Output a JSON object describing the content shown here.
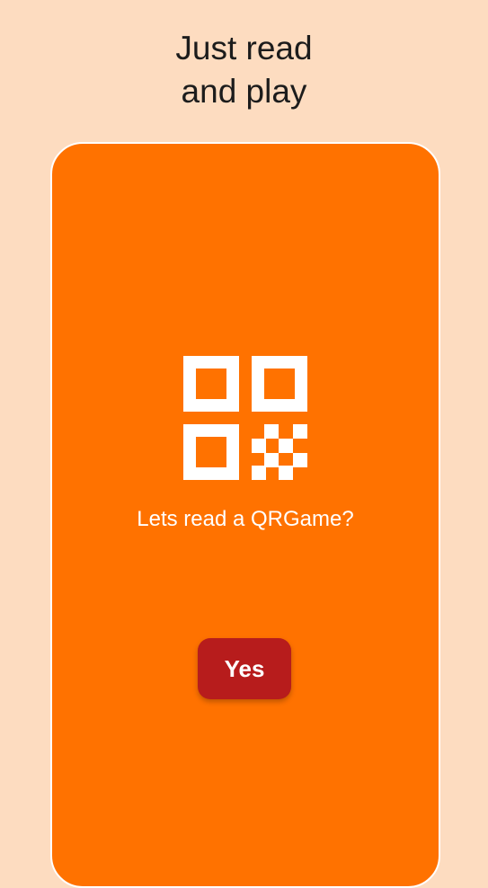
{
  "headline": {
    "line1": "Just read",
    "line2": "and play"
  },
  "card": {
    "icon": "qr-code-icon",
    "prompt": "Lets read a QRGame?",
    "yes_label": "Yes"
  },
  "colors": {
    "background": "#FDDCC0",
    "card": "#FF7200",
    "button": "#B71C1C",
    "text_light": "#FFFFFF",
    "text_dark": "#1C1C1C"
  }
}
